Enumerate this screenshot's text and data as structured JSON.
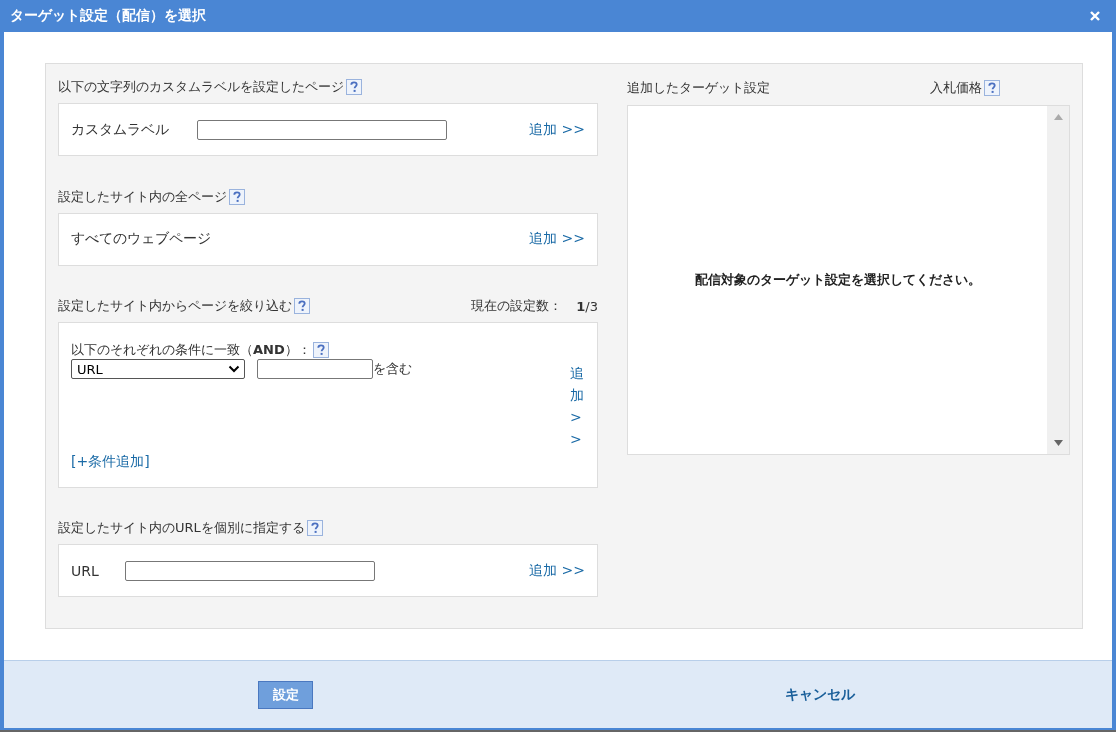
{
  "dialog": {
    "title": "ターゲット設定（配信）を選択"
  },
  "sections": [
    {
      "kind": "field",
      "heading": "以下の文字列のカスタムラベルを設定したページ",
      "label": "カスタムラベル",
      "action": "追加 >>"
    },
    {
      "kind": "plain",
      "heading": "設定したサイト内の全ページ",
      "text": "すべてのウェブページ",
      "action": "追加 >>"
    },
    {
      "kind": "conditions",
      "heading": "設定したサイト内からページを絞り込む",
      "count_label": "現在の設定数：",
      "count": "**1**/3",
      "condition_title": "以下のそれぞれの条件に一致（**AND**）：",
      "select_value": "URL",
      "suffix": "を含む",
      "action": "追加 >>",
      "add_condition": "[+条件追加]"
    },
    {
      "kind": "url",
      "heading": "設定したサイト内のURLを個別に指定する",
      "label": "URL",
      "action": "追加 >>"
    }
  ],
  "targets": {
    "heading": "追加したターゲット設定",
    "price_heading": "入札価格",
    "empty_message": "配信対象のターゲット設定を選択してください。"
  },
  "footer": {
    "confirm": "設定",
    "cancel": "キャンセル"
  }
}
